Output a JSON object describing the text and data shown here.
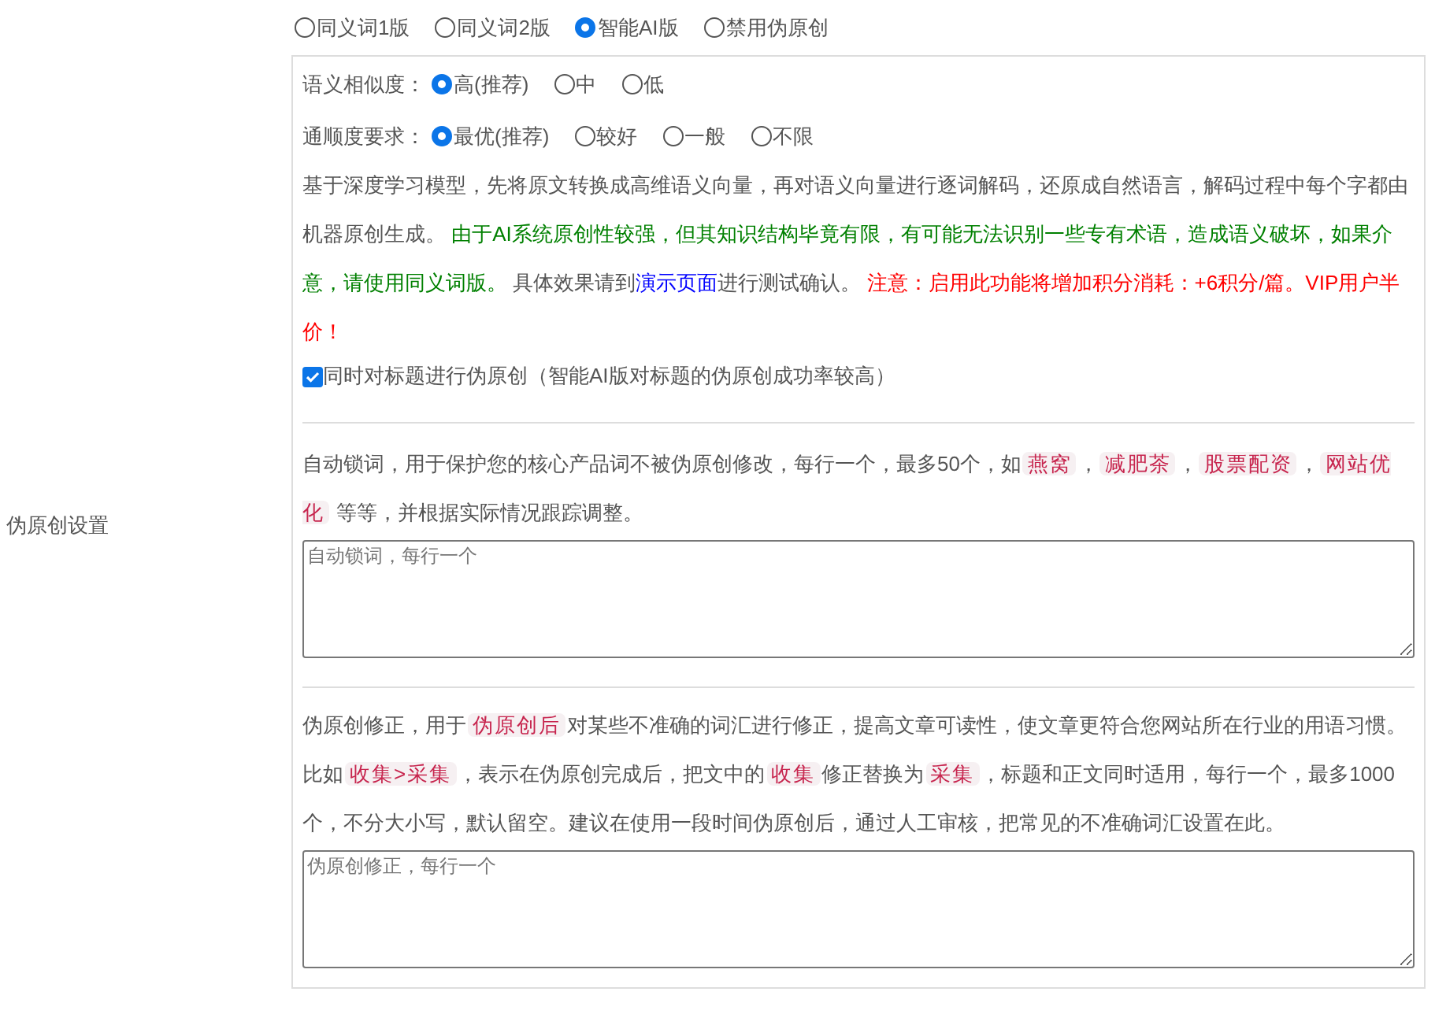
{
  "side_label": "伪原创设置",
  "modes": [
    {
      "label": "同义词1版",
      "selected": false
    },
    {
      "label": "同义词2版",
      "selected": false
    },
    {
      "label": "智能AI版",
      "selected": true
    },
    {
      "label": "禁用伪原创",
      "selected": false
    }
  ],
  "option_groups": [
    {
      "label": "语义相似度：",
      "options": [
        {
          "label": "高(推荐)",
          "selected": true
        },
        {
          "label": "中",
          "selected": false
        },
        {
          "label": "低",
          "selected": false
        }
      ]
    },
    {
      "label": "通顺度要求：",
      "options": [
        {
          "label": "最优(推荐)",
          "selected": true
        },
        {
          "label": "较好",
          "selected": false
        },
        {
          "label": "一般",
          "selected": false
        },
        {
          "label": "不限",
          "selected": false
        }
      ]
    }
  ],
  "ai_description": [
    {
      "kind": "text",
      "text": "基于深度学习模型，先将原文转换成高维语义向量，再对语义向量进行逐词解码，还原成自然语言，解码过程中每个字都由机器原创生成。 "
    },
    {
      "kind": "success",
      "text": "由于AI系统原创性较强，但其知识结构毕竟有限，有可能无法识别一些专有术语，造成语义破坏，如果介意，请使用同义词版。"
    },
    {
      "kind": "text",
      "text": " 具体效果请到"
    },
    {
      "kind": "link",
      "text": "演示页面"
    },
    {
      "kind": "text",
      "text": "进行测试确认。 "
    },
    {
      "kind": "warning",
      "text": "注意：启用此功能将增加积分消耗：+6积分/篇。VIP用户半价！"
    }
  ],
  "title_option": {
    "label": "同时对标题进行伪原创（智能AI版对标题的伪原创成功率较高）",
    "checked": true
  },
  "lock_words": {
    "description": [
      {
        "kind": "text",
        "text": "自动锁词，用于保护您的核心产品词不被伪原创修改，每行一个，最多50个，如"
      },
      {
        "kind": "code",
        "text": "燕窝"
      },
      {
        "kind": "text",
        "text": "，"
      },
      {
        "kind": "code",
        "text": "减肥茶"
      },
      {
        "kind": "text",
        "text": "，"
      },
      {
        "kind": "code",
        "text": "股票配资"
      },
      {
        "kind": "text",
        "text": "，"
      },
      {
        "kind": "code",
        "text": "网站优化"
      },
      {
        "kind": "text",
        "text": " 等等，并根据实际情况跟踪调整。"
      }
    ],
    "placeholder": "自动锁词，每行一个"
  },
  "corrections": {
    "description": [
      {
        "kind": "text",
        "text": "伪原创修正，用于"
      },
      {
        "kind": "code",
        "text": "伪原创后"
      },
      {
        "kind": "text",
        "text": "对某些不准确的词汇进行修正，提高文章可读性，使文章更符合您网站所在行业的用语习惯。比如"
      },
      {
        "kind": "code",
        "text": "收集>采集"
      },
      {
        "kind": "text",
        "text": "，表示在伪原创完成后，把文中的"
      },
      {
        "kind": "code",
        "text": "收集"
      },
      {
        "kind": "text",
        "text": "修正替换为"
      },
      {
        "kind": "code",
        "text": "采集"
      },
      {
        "kind": "text",
        "text": "，标题和正文同时适用，每行一个，最多1000个，不分大小写，默认留空。建议在使用一段时间伪原创后，通过人工审核，把常见的不准确词汇设置在此。"
      }
    ],
    "placeholder": "伪原创修正，每行一个"
  }
}
